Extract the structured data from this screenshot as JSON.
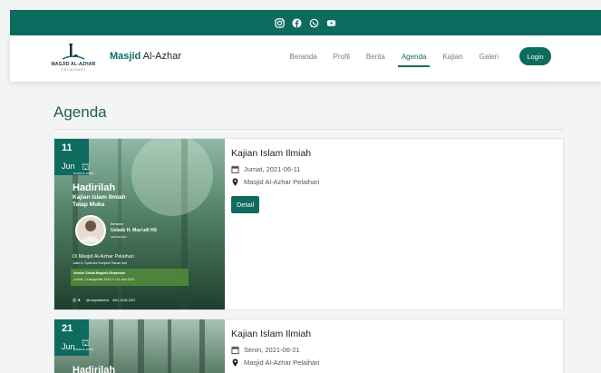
{
  "social": {
    "icons": [
      "instagram-icon",
      "facebook-icon",
      "whatsapp-icon",
      "youtube-icon"
    ]
  },
  "header": {
    "logo_text": "MASJID AL-AZHAR",
    "logo_sub": "PELAIHARI",
    "brand_bold": "Masjid",
    "brand_rest": " Al-Azhar",
    "nav": [
      {
        "label": "Beranda",
        "active": false
      },
      {
        "label": "Profil",
        "active": false
      },
      {
        "label": "Berita",
        "active": false
      },
      {
        "label": "Agenda",
        "active": true
      },
      {
        "label": "Kajian",
        "active": false
      },
      {
        "label": "Galeri",
        "active": false
      }
    ],
    "login_label": "Login"
  },
  "main": {
    "title": "Agenda",
    "events": [
      {
        "day": "11",
        "month": "Jun",
        "title": "Kajian Islam Ilmiah",
        "date_text": "Jumat, 2021-06-11",
        "location": "Masjid Al-Azhar Pelaihari",
        "detail_label": "Detail",
        "poster": {
          "mini_logo": "MASJID AL-AZHAR",
          "heading": "Hadirilah",
          "subheading": "Kajian Islam Ilmiah",
          "subheading2": "Tatap Muka",
          "with_label": "Bersama",
          "speaker": "Ustadz H. Mas'udi HS",
          "speaker_role": "hafizhahullah",
          "venue": "Di Masjid Al-Azhar Pelaihari",
          "address": "Jalan A. Syahrani Komplek Taman Asri",
          "time1": "Setelah Shalat Maghrib Berjamaah",
          "time2": "Jum'at, 1 Dzulqa'dah 1442 H / 11 Juni 2021",
          "footer_handle": "@masjidalazhar",
          "footer_phone": "0811-5136-2007"
        }
      },
      {
        "day": "21",
        "month": "Jun",
        "title": "Kajian Islam Ilmiah",
        "date_text": "Senin, 2021-06-21",
        "location": "Masjid Al-Azhar Pelaihari",
        "poster": {
          "mini_logo": "MASJID AL-AZHAR",
          "heading": "Hadirilah"
        }
      }
    ]
  },
  "colors": {
    "primary": "#0e6b5f",
    "background": "#f3f4f4"
  }
}
